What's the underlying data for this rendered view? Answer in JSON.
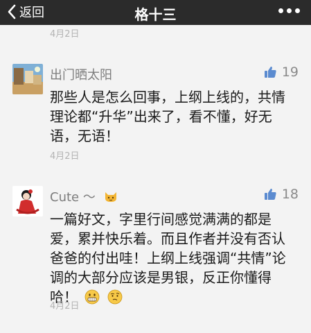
{
  "navbar": {
    "back_label": "返回",
    "title": "格十三"
  },
  "top_date": "4月2日",
  "comments": [
    {
      "username": "出门晒太阳",
      "likes": "19",
      "lines": [
        "那些人是怎么回事，上纲上线的，共情",
        "理论都“升华”出来了，看不懂，好无",
        "语，无语！"
      ],
      "date": "4月2日"
    },
    {
      "username": "Cute ～",
      "likes": "18",
      "lines": [
        "一篇好文，字里行间感觉满满的都是",
        "爱，累并快乐着。而且作者并没有否认",
        "爸爸的付出哇！上纲上线强调“共情”论",
        "调的大部分应该是男银，反正你懂得",
        "哈！"
      ],
      "date": "4月2日"
    }
  ],
  "colors": {
    "navbar_bg": "#2b2b2b",
    "like_icon": "#5b8bd0"
  }
}
